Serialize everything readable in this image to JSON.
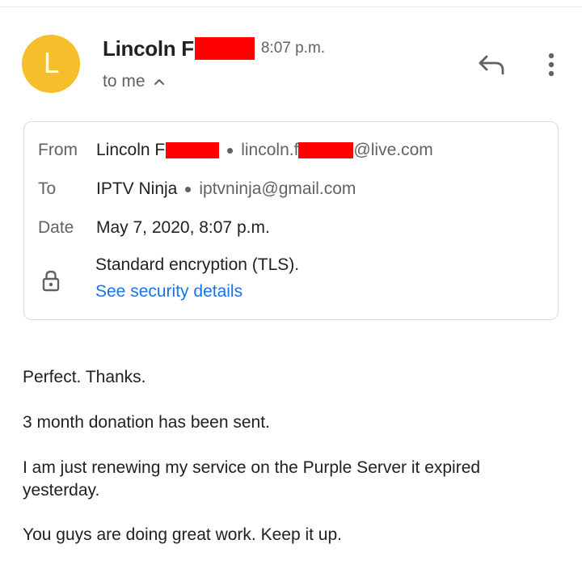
{
  "header": {
    "avatar_letter": "L",
    "sender_name": "Lincoln F",
    "time": "8:07 p.m.",
    "to_me": "to me"
  },
  "details": {
    "from_label": "From",
    "from_name": "Lincoln F",
    "from_email_prefix": "lincoln.f",
    "from_email_suffix": "@live.com",
    "to_label": "To",
    "to_name": "IPTV Ninja",
    "to_email": "iptvninja@gmail.com",
    "date_label": "Date",
    "date_value": "May 7, 2020, 8:07 p.m.",
    "encryption": "Standard encryption (TLS).",
    "security_link": "See security details"
  },
  "message": {
    "paragraphs": [
      "Perfect. Thanks.",
      "3 month donation has been sent.",
      "I am just renewing my service on the Purple Server it expired yesterday.",
      "You guys are doing great work. Keep it up."
    ]
  },
  "colors": {
    "avatar": "#f4bf2a",
    "link": "#1a73e8",
    "redaction": "#ff0000"
  },
  "icons": {
    "reply": "reply-icon",
    "more": "more-vert-icon",
    "lock": "lock-icon",
    "chevron": "chevron-up-icon"
  }
}
